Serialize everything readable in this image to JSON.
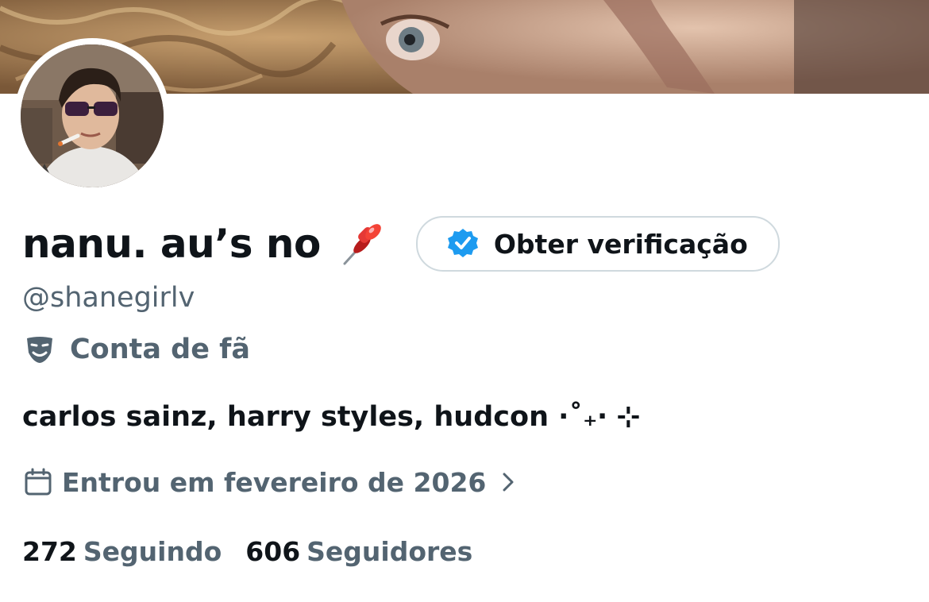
{
  "banner": {
    "image": "close-up face photo header"
  },
  "avatar": {
    "image": "profile photo"
  },
  "profile": {
    "display_name": "nanu. au’s no",
    "name_emoji_icon": "pushpin-icon",
    "verify_button_label": "Obter verificação",
    "handle": "@shanegirlv",
    "category_label": "Conta de fã",
    "bio": "carlos sainz, harry styles, hudcon ⋅˚₊‧ ⊹",
    "joined_label": "Entrou em fevereiro de 2026"
  },
  "stats": {
    "following_count": "272",
    "following_label": "Seguindo",
    "followers_count": "606",
    "followers_label": "Seguidores"
  },
  "colors": {
    "text_primary": "#0f1419",
    "text_secondary": "#536471",
    "verified_blue": "#1d9bf0",
    "border": "#cfd9de"
  }
}
